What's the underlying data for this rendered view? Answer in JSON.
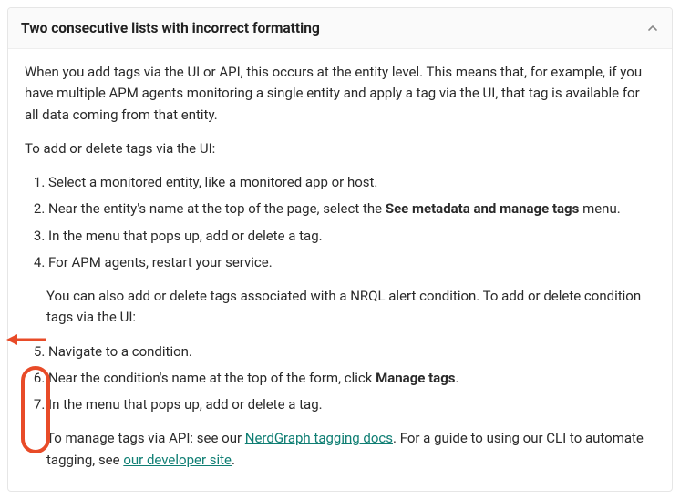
{
  "header": {
    "title": "Two consecutive lists with incorrect formatting"
  },
  "intro": "When you add tags via the UI or API, this occurs at the entity level. This means that, for example, if you have multiple APM agents monitoring a single entity and apply a tag via the UI, that tag is available for all data coming from that entity.",
  "addDeleteLead": "To add or delete tags via the UI:",
  "steps": [
    "Select a monitored entity, like a monitored app or host.",
    "Near the entity's name at the top of the page, select the ",
    "In the menu that pops up, add or delete a tag.",
    "For APM agents, restart your service."
  ],
  "step2_bold": "See metadata and manage tags",
  "step2_suffix": " menu.",
  "nrqlLead": "You can also add or delete tags associated with a NRQL alert condition. To add or delete condition tags via the UI:",
  "nrqlSteps": [
    "Navigate to a condition.",
    "Near the condition's name at the top of the form, click ",
    "In the menu that pops up, add or delete a tag."
  ],
  "nrql_step2_bold": "Manage tags",
  "nrql_step2_suffix": ".",
  "footer_pre": "To manage tags via API: see our ",
  "footer_link1": "NerdGraph tagging docs",
  "footer_mid": ". For a guide to using our CLI to automate tagging, see ",
  "footer_link2": "our developer site",
  "footer_end": "."
}
